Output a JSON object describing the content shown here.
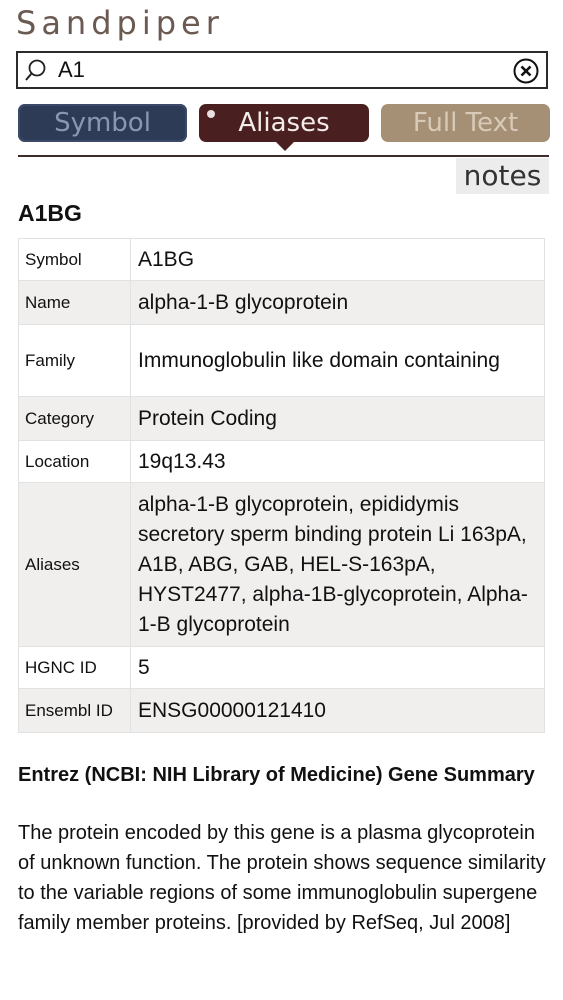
{
  "app": {
    "title": "Sandpiper"
  },
  "search": {
    "value": "A1"
  },
  "tabs": [
    {
      "label": "Symbol",
      "selected": false
    },
    {
      "label": "Aliases",
      "selected": true
    },
    {
      "label": "Full Text",
      "selected": false
    }
  ],
  "notes_label": "notes",
  "gene": {
    "heading": "A1BG",
    "rows": [
      {
        "key": "Symbol",
        "value": "A1BG"
      },
      {
        "key": "Name",
        "value": "alpha-1-B glycoprotein"
      },
      {
        "key": "Family",
        "value": "Immunoglobulin like domain containing"
      },
      {
        "key": "Category",
        "value": "Protein Coding"
      },
      {
        "key": "Location",
        "value": "19q13.43"
      },
      {
        "key": "Aliases",
        "value": "alpha-1-B glycoprotein, epididymis secretory sperm binding protein Li 163pA, A1B, ABG, GAB, HEL-S-163pA, HYST2477, alpha-1B-glycoprotein, Alpha-1-B glycoprotein"
      },
      {
        "key": "HGNC ID",
        "value": "5"
      },
      {
        "key": "Ensembl ID",
        "value": "ENSG00000121410"
      }
    ]
  },
  "summary": {
    "title": "Entrez (NCBI: NIH Library of Medicine) Gene Summary",
    "text": "The protein encoded by this gene is a plasma glycoprotein of unknown function. The protein shows sequence similarity to the variable regions of some immunoglobulin supergene family member proteins. [provided by RefSeq, Jul 2008]"
  },
  "colors": {
    "title": "#6b5a52",
    "tab_symbol": "#2e3b57",
    "tab_aliases": "#4a1f1f",
    "tab_fulltext": "#a59075"
  }
}
